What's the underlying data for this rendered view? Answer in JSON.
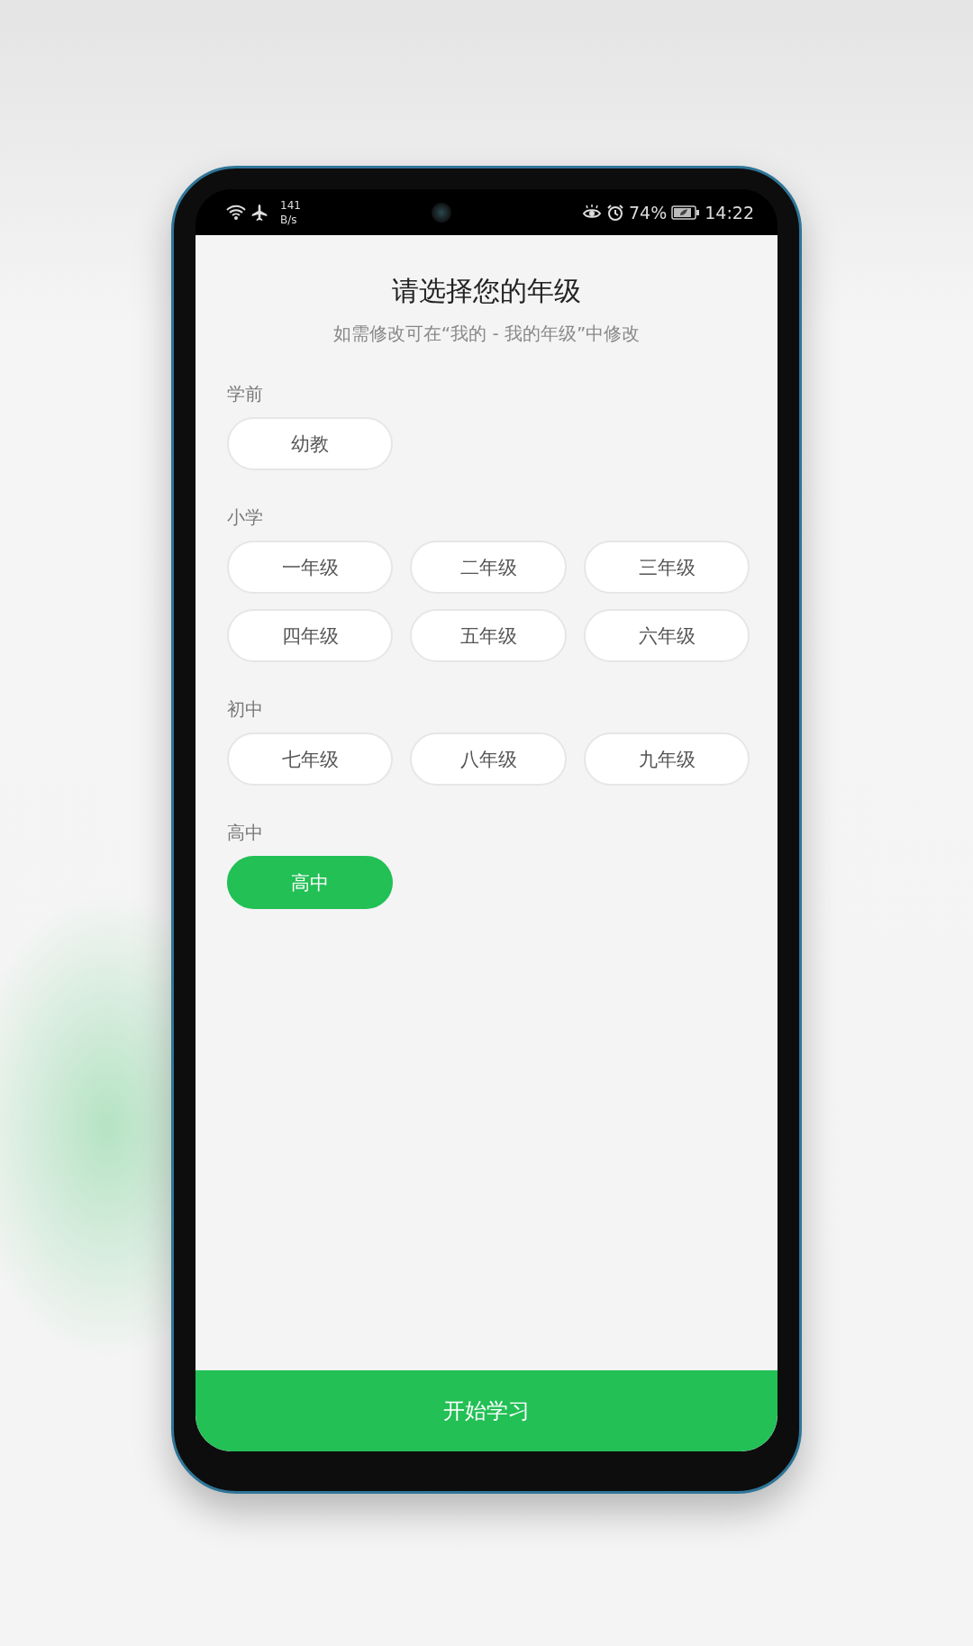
{
  "status_bar": {
    "network_speed": "141",
    "network_unit": "B/s",
    "battery": "74%",
    "time": "14:22"
  },
  "title": "请选择您的年级",
  "subtitle": "如需修改可在“我的 - 我的年级”中修改",
  "sections": [
    {
      "label": "学前",
      "options": [
        {
          "label": "幼教",
          "selected": false
        }
      ]
    },
    {
      "label": "小学",
      "options": [
        {
          "label": "一年级",
          "selected": false
        },
        {
          "label": "二年级",
          "selected": false
        },
        {
          "label": "三年级",
          "selected": false
        },
        {
          "label": "四年级",
          "selected": false
        },
        {
          "label": "五年级",
          "selected": false
        },
        {
          "label": "六年级",
          "selected": false
        }
      ]
    },
    {
      "label": "初中",
      "options": [
        {
          "label": "七年级",
          "selected": false
        },
        {
          "label": "八年级",
          "selected": false
        },
        {
          "label": "九年级",
          "selected": false
        }
      ]
    },
    {
      "label": "高中",
      "options": [
        {
          "label": "高中",
          "selected": true
        }
      ]
    }
  ],
  "start_button": "开始学习"
}
